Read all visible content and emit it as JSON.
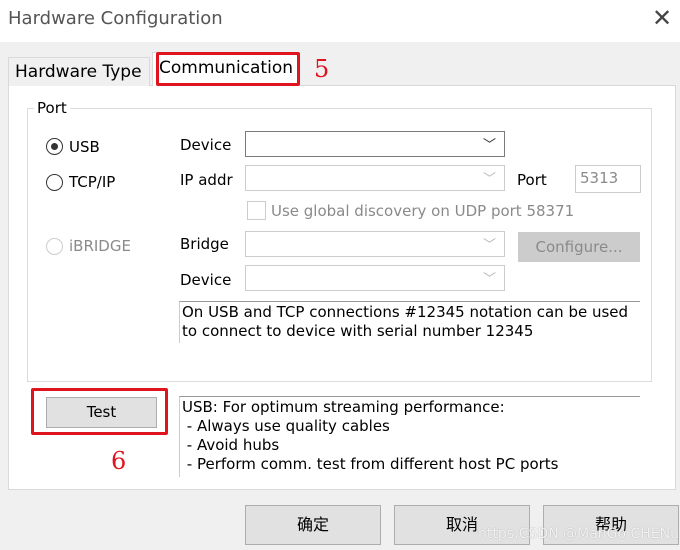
{
  "window": {
    "title": "Hardware Configuration",
    "close_icon": "close-icon"
  },
  "tabs": [
    {
      "label": "Hardware Type",
      "selected": false
    },
    {
      "label": "Communication",
      "selected": true
    }
  ],
  "annotations": {
    "tab_marker": "5",
    "test_marker": "6",
    "highlight_color": "#e0141e"
  },
  "port_group": {
    "label": "Port",
    "radios": [
      {
        "label": "USB",
        "checked": true,
        "enabled": true
      },
      {
        "label": "TCP/IP",
        "checked": false,
        "enabled": true
      },
      {
        "label": "iBRIDGE",
        "checked": false,
        "enabled": false
      }
    ],
    "device_label": "Device",
    "device_value": "",
    "ip_label": "IP addr",
    "ip_value": "",
    "port_label": "Port",
    "port_value": "5313",
    "udp_checkbox": {
      "label": "Use global discovery on UDP port 58371",
      "checked": false
    },
    "bridge_label": "Bridge",
    "bridge_value": "",
    "configure_label": "Configure...",
    "device2_label": "Device",
    "device2_value": "",
    "info": "On USB and TCP connections #12345 notation can be used to connect to device with serial number 12345"
  },
  "test": {
    "label": "Test",
    "lines": [
      "USB: For optimum streaming performance:",
      " - Always use quality cables",
      " - Avoid hubs",
      " - Perform comm. test from different host PC ports"
    ]
  },
  "footer": {
    "ok": "确定",
    "cancel": "取消",
    "help": "帮助"
  },
  "watermark": "https:CSDN @ManGo CHENu"
}
